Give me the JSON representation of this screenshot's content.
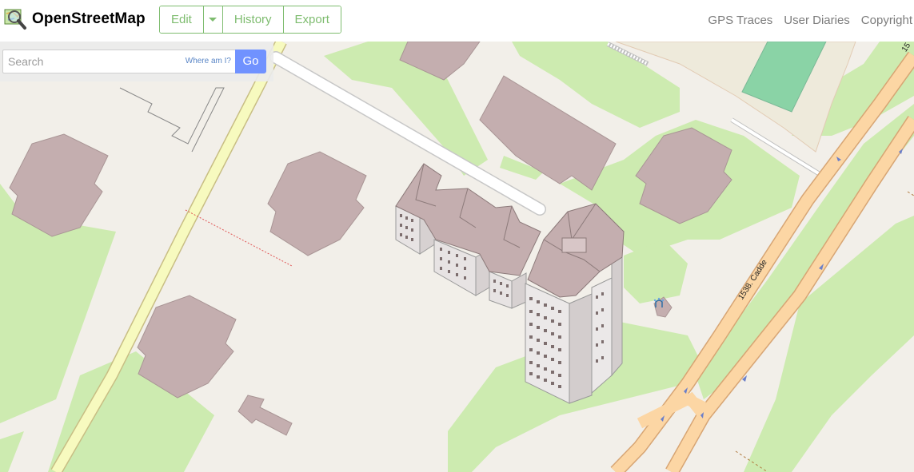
{
  "brand": {
    "name": "OpenStreetMap",
    "icon": "magnifier-map-icon"
  },
  "toolbar": {
    "edit": "Edit",
    "edit_dropdown_icon": "caret-down-icon",
    "history": "History",
    "export": "Export"
  },
  "nav": {
    "gps_traces": "GPS Traces",
    "user_diaries": "User Diaries",
    "copyright": "Copyright"
  },
  "search": {
    "placeholder": "Search",
    "where_am_i": "Where am I?",
    "go": "Go"
  },
  "map": {
    "road_label": "1538. Cadde",
    "road_label_top": "15",
    "poi_icon": "fountain-icon",
    "colors": {
      "land": "#f2efe9",
      "grass": "#cdebb0",
      "building": "#c4aeaf",
      "primary_road": "#fcd6a4",
      "secondary_road": "#f7fabf",
      "pitch": "#8ad3a6",
      "accent": "#7ebc6f",
      "go_button": "#7092ff"
    }
  }
}
